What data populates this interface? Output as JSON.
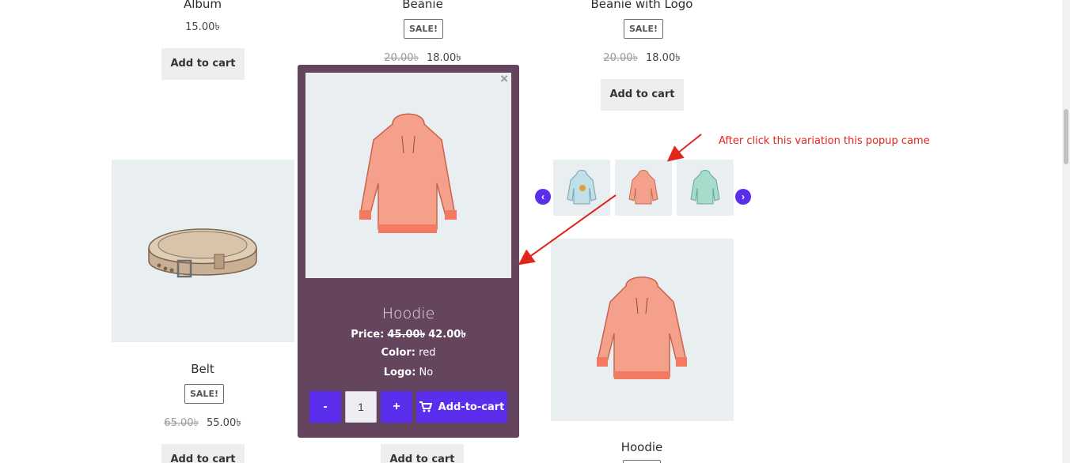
{
  "products_top": [
    {
      "title": "Album",
      "price": "15.00৳"
    },
    {
      "title": "Beanie",
      "sale": "SALE!",
      "old_price": "20.00৳",
      "new_price": "18.00৳"
    },
    {
      "title": "Beanie with Logo",
      "sale": "SALE!",
      "old_price": "20.00৳",
      "new_price": "18.00৳",
      "cart": "Add to cart"
    }
  ],
  "album_cart": "Add to cart",
  "belt": {
    "title": "Belt",
    "sale": "SALE!",
    "old_price": "65.00৳",
    "new_price": "55.00৳",
    "cart": "Add to cart"
  },
  "hoodie_card": {
    "title": "Hoodie"
  },
  "bottom_cart": "Add to cart",
  "popup": {
    "close": "×",
    "title": "Hoodie",
    "price_label": "Price:",
    "old_price": "45.00৳",
    "new_price": "42.00৳",
    "color_label": "Color:",
    "color_value": "red",
    "logo_label": "Logo:",
    "logo_value": "No",
    "minus": "-",
    "qty": "1",
    "plus": "+",
    "add_to_cart": "Add-to-cart"
  },
  "carousel": {
    "prev": "‹",
    "next": "›"
  },
  "annotation": "After click this variation this popup came",
  "colors": {
    "popup_bg": "#65445e",
    "accent": "#5b2ded",
    "arrow": "#e0261b"
  }
}
